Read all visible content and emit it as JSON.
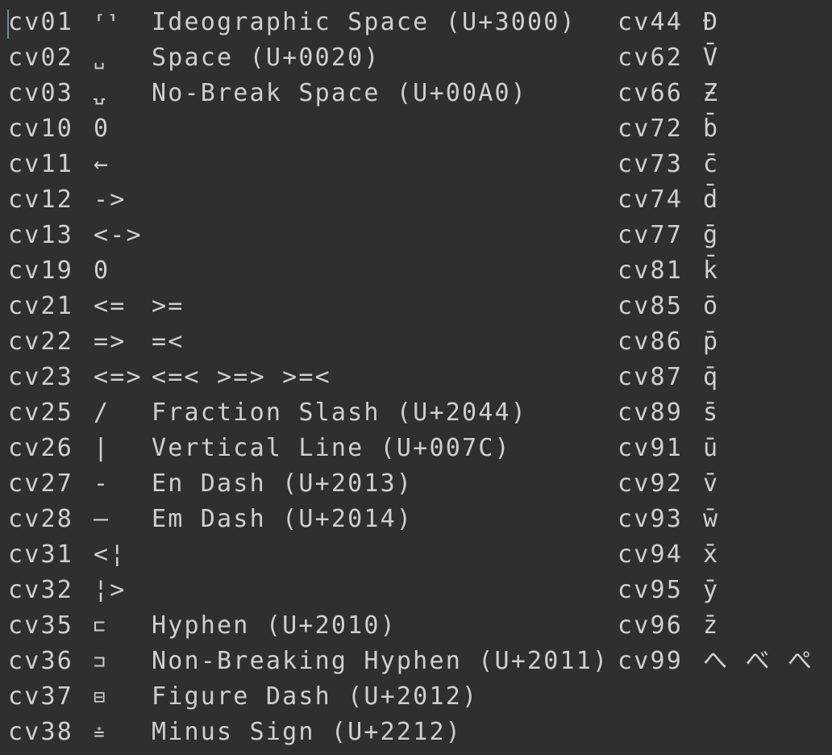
{
  "left_column": [
    {
      "code": "cv01",
      "glyph": "⸢⸣",
      "desc": "Ideographic Space (U+3000)"
    },
    {
      "code": "cv02",
      "glyph": "␣",
      "desc": "Space (U+0020)"
    },
    {
      "code": "cv03",
      "glyph": "⍽",
      "desc": "No-Break Space (U+00A0)"
    },
    {
      "code": "cv10",
      "glyph": "0",
      "desc": ""
    },
    {
      "code": "cv11",
      "glyph": "←",
      "desc": ""
    },
    {
      "code": "cv12",
      "glyph": "->",
      "desc": ""
    },
    {
      "code": "cv13",
      "glyph": "<->",
      "desc": ""
    },
    {
      "code": "cv19",
      "glyph": "0",
      "desc": ""
    },
    {
      "code": "cv21",
      "glyph": "<=",
      "desc": ">="
    },
    {
      "code": "cv22",
      "glyph": "=>",
      "desc": "=<"
    },
    {
      "code": "cv23",
      "glyph": "<=>",
      "desc": "<=< >=> >=<"
    },
    {
      "code": "cv25",
      "glyph": "/",
      "desc": "Fraction Slash (U+2044)"
    },
    {
      "code": "cv26",
      "glyph": "|",
      "desc": "Vertical Line (U+007C)"
    },
    {
      "code": "cv27",
      "glyph": "-",
      "desc": "En Dash (U+2013)"
    },
    {
      "code": "cv28",
      "glyph": "—",
      "desc": "Em Dash (U+2014)"
    },
    {
      "code": "cv31",
      "glyph": "<¦",
      "desc": ""
    },
    {
      "code": "cv32",
      "glyph": "¦>",
      "desc": ""
    },
    {
      "code": "cv35",
      "glyph": "⊏",
      "desc": "Hyphen (U+2010)"
    },
    {
      "code": "cv36",
      "glyph": "⊐",
      "desc": "Non-Breaking Hyphen (U+2011)"
    },
    {
      "code": "cv37",
      "glyph": "⊟",
      "desc": "Figure Dash (U+2012)"
    },
    {
      "code": "cv38",
      "glyph": "⩮",
      "desc": "Minus Sign (U+2212)"
    }
  ],
  "right_column": [
    {
      "code": "cv44",
      "glyph": "Đ"
    },
    {
      "code": "cv62",
      "glyph": "V̄"
    },
    {
      "code": "cv66",
      "glyph": "Ƶ"
    },
    {
      "code": "cv72",
      "glyph": "b̄"
    },
    {
      "code": "cv73",
      "glyph": "c̄"
    },
    {
      "code": "cv74",
      "glyph": "d̄"
    },
    {
      "code": "cv77",
      "glyph": "ḡ"
    },
    {
      "code": "cv81",
      "glyph": "k̄"
    },
    {
      "code": "cv85",
      "glyph": "ō"
    },
    {
      "code": "cv86",
      "glyph": "p̄"
    },
    {
      "code": "cv87",
      "glyph": "q̄"
    },
    {
      "code": "cv89",
      "glyph": "s̄"
    },
    {
      "code": "cv91",
      "glyph": "ū"
    },
    {
      "code": "cv92",
      "glyph": "v̄"
    },
    {
      "code": "cv93",
      "glyph": "w̄"
    },
    {
      "code": "cv94",
      "glyph": "x̄"
    },
    {
      "code": "cv95",
      "glyph": "ȳ"
    },
    {
      "code": "cv96",
      "glyph": "z̄"
    },
    {
      "code": "cv99",
      "glyph": "へ べ ぺ"
    }
  ],
  "colors": {
    "background": "#2f2f2f",
    "text": "#cfcfcf",
    "cursor": "#6c8c9c"
  }
}
